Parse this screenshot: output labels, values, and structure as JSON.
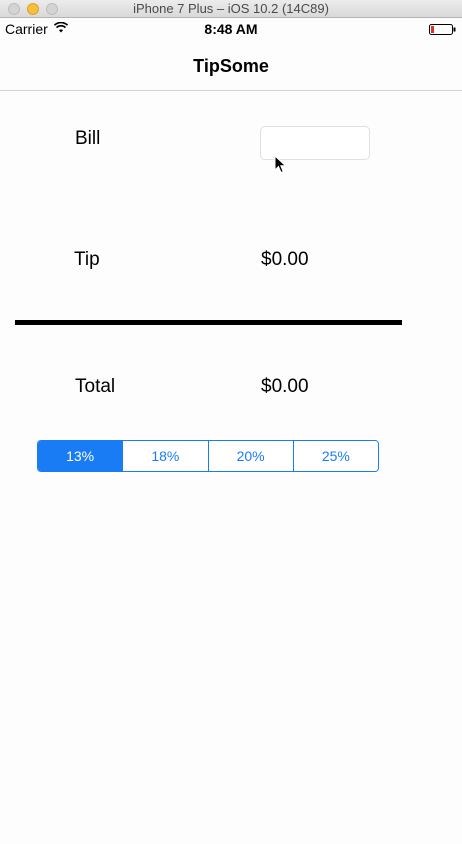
{
  "window": {
    "title": "iPhone 7 Plus – iOS 10.2 (14C89)"
  },
  "status_bar": {
    "carrier": "Carrier",
    "time": "8:48 AM",
    "battery_color": "#e0302b"
  },
  "nav": {
    "title": "TipSome"
  },
  "bill": {
    "label": "Bill",
    "value": "",
    "placeholder": ""
  },
  "tip": {
    "label": "Tip",
    "value": "$0.00"
  },
  "total": {
    "label": "Total",
    "value": "$0.00"
  },
  "tip_selector": {
    "options": [
      "13%",
      "18%",
      "20%",
      "25%"
    ],
    "selected_index": 0,
    "accent_color": "#1a7cf5"
  }
}
